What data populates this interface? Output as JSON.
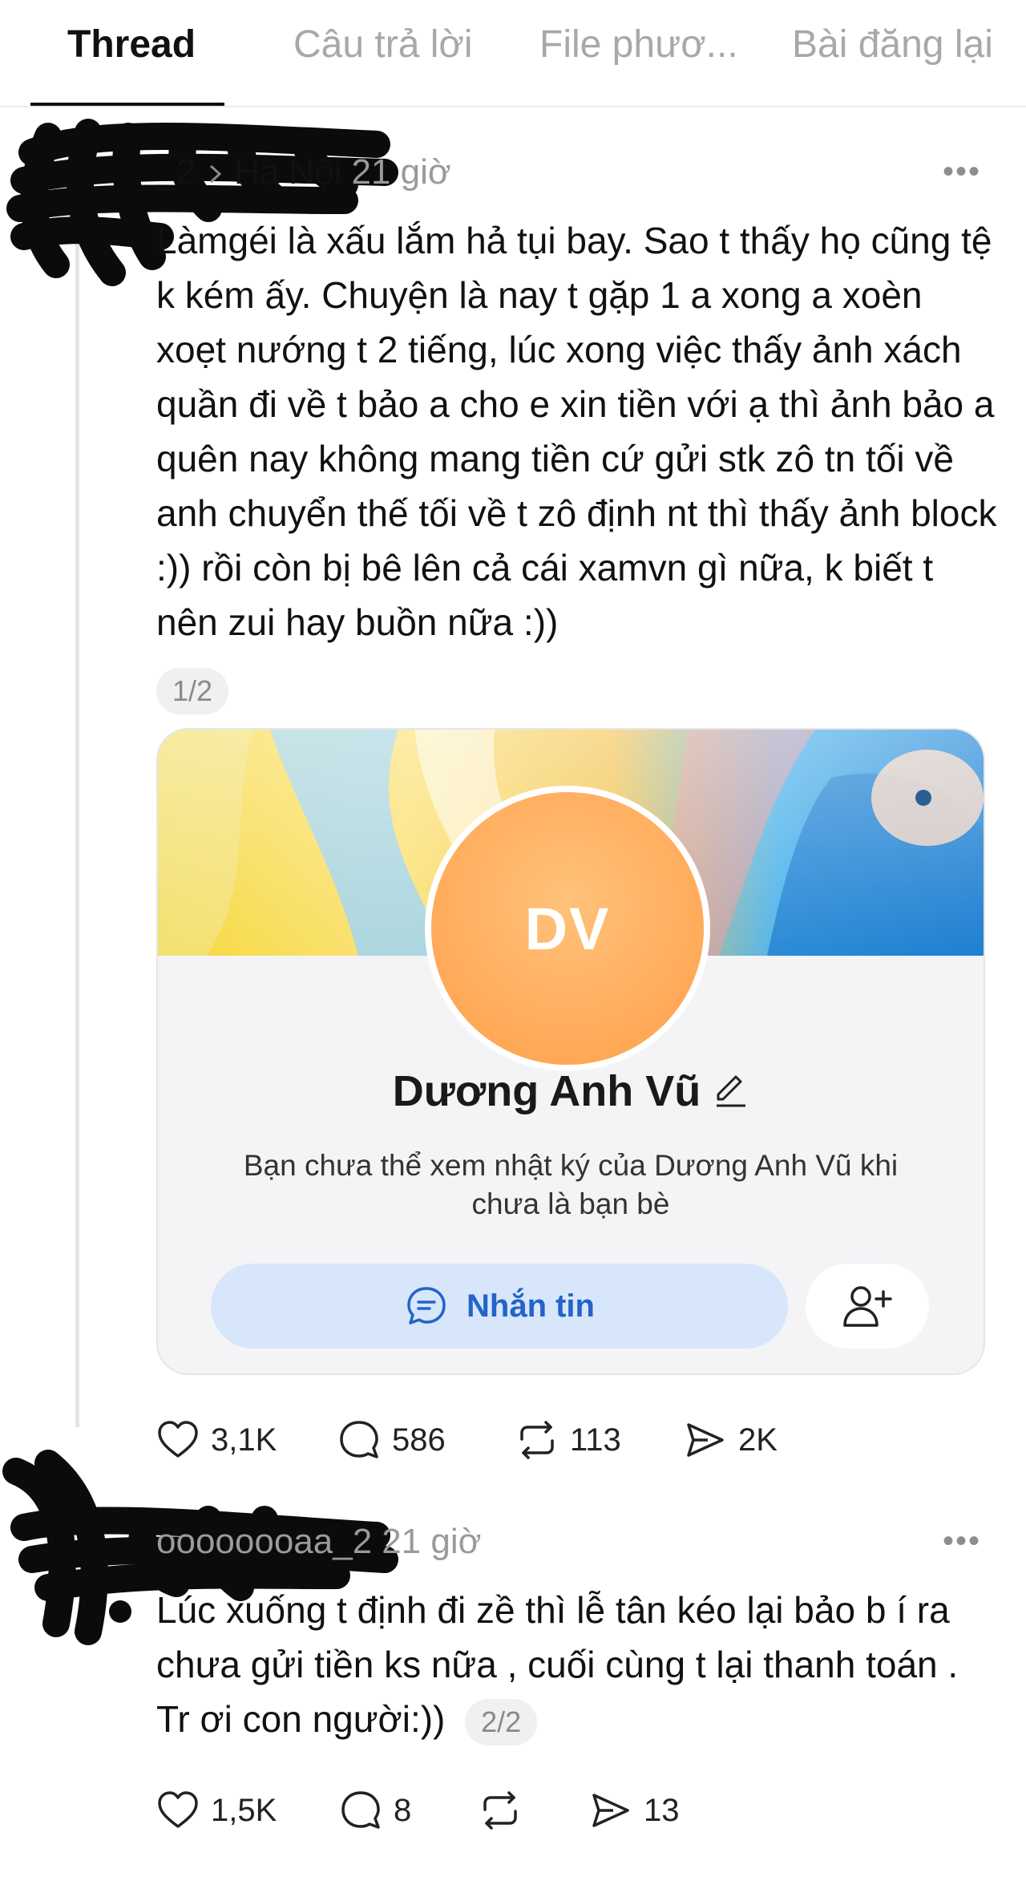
{
  "tabs": [
    {
      "label": "Thread",
      "active": true
    },
    {
      "label": "Câu trả lời",
      "active": false
    },
    {
      "label": "File phươ...",
      "active": false
    },
    {
      "label": "Bài đăng lại",
      "active": false
    }
  ],
  "post1": {
    "username": "_2",
    "location": "Hà Nội",
    "time": "21 giờ",
    "more": "•••",
    "text": "Làmgéi là xấu lắm hả tụi bay. Sao t thấy họ cũng tệ k kém ấy. Chuyện là nay t gặp 1 a xong a xoèn xoẹt nướng t 2 tiếng, lúc xong việc thấy ảnh xách quần đi về t bảo a cho e xin tiền với ạ thì ảnh bảo a quên nay không mang tiền cứ gửi stk zô tn tối về anh chuyển thế tối về t zô định nt  thì thấy ảnh block :)) rồi còn bị bê lên cả cái xamvn gì nữa, k biết t nên zui hay buồn nữa :))",
    "pager": "1/2",
    "card": {
      "initials": "DV",
      "name": "Dương Anh Vũ",
      "description": "Bạn chưa thể xem nhật ký của Dương Anh Vũ khi chưa là bạn bè",
      "message_button": "Nhắn tin"
    },
    "stats": {
      "likes": "3,1K",
      "comments": "586",
      "reposts": "113",
      "shares": "2K"
    }
  },
  "post2": {
    "username": "oooooooaa_2",
    "time": "21 giờ",
    "more": "•••",
    "text": "Lúc xuống t định đi zề thì lễ tân kéo lại bảo b í ra chưa gửi tiền ks nữa , cuối cùng t lại thanh toán . Tr ơi con người:))",
    "pager": "2/2",
    "stats": {
      "likes": "1,5K",
      "comments": "8",
      "reposts": "",
      "shares": "13"
    }
  },
  "icons": {
    "like": "heart-icon",
    "comment": "comment-bubble-icon",
    "repost": "repost-icon",
    "share": "send-icon",
    "chat": "chat-icon",
    "add_friend": "add-friend-icon",
    "edit": "pencil-icon"
  },
  "colors": {
    "accent": "#2464c8",
    "avatar": "#ffa64f",
    "muted": "#9a9a9a"
  }
}
